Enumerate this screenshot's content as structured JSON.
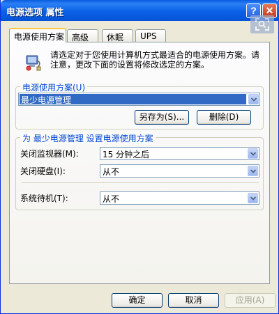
{
  "window": {
    "title": "电源选项 属性",
    "help_symbol": "?",
    "close_symbol": "✕"
  },
  "tabs": [
    {
      "label": "电源使用方案",
      "active": true
    },
    {
      "label": "高级"
    },
    {
      "label": "休眠"
    },
    {
      "label": "UPS"
    }
  ],
  "intro_text": "请选定对于您使用计算机方式最适合的电源使用方案。请注意，更改下面的设置将修改选定的方案。",
  "scheme_group": {
    "legend": "电源使用方案(U)",
    "selected": "最少电源管理",
    "save_as_label": "另存为(S)...",
    "delete_label": "删除(D)"
  },
  "settings_group": {
    "legend": "为 最少电源管理 设置电源使用方案",
    "rows": [
      {
        "label": "关闭监视器(M):",
        "value": "15 分钟之后"
      },
      {
        "label": "关闭硬盘(I):",
        "value": "从不"
      },
      {
        "label": "系统待机(T):",
        "value": "从不"
      }
    ]
  },
  "footer": {
    "ok_label": "确定",
    "cancel_label": "取消",
    "apply_label": "应用(A)"
  },
  "colors": {
    "title_bar": "#0a5ddf",
    "selection": "#316ac5",
    "group_label": "#0046d5",
    "window_bg": "#ece9d8"
  }
}
